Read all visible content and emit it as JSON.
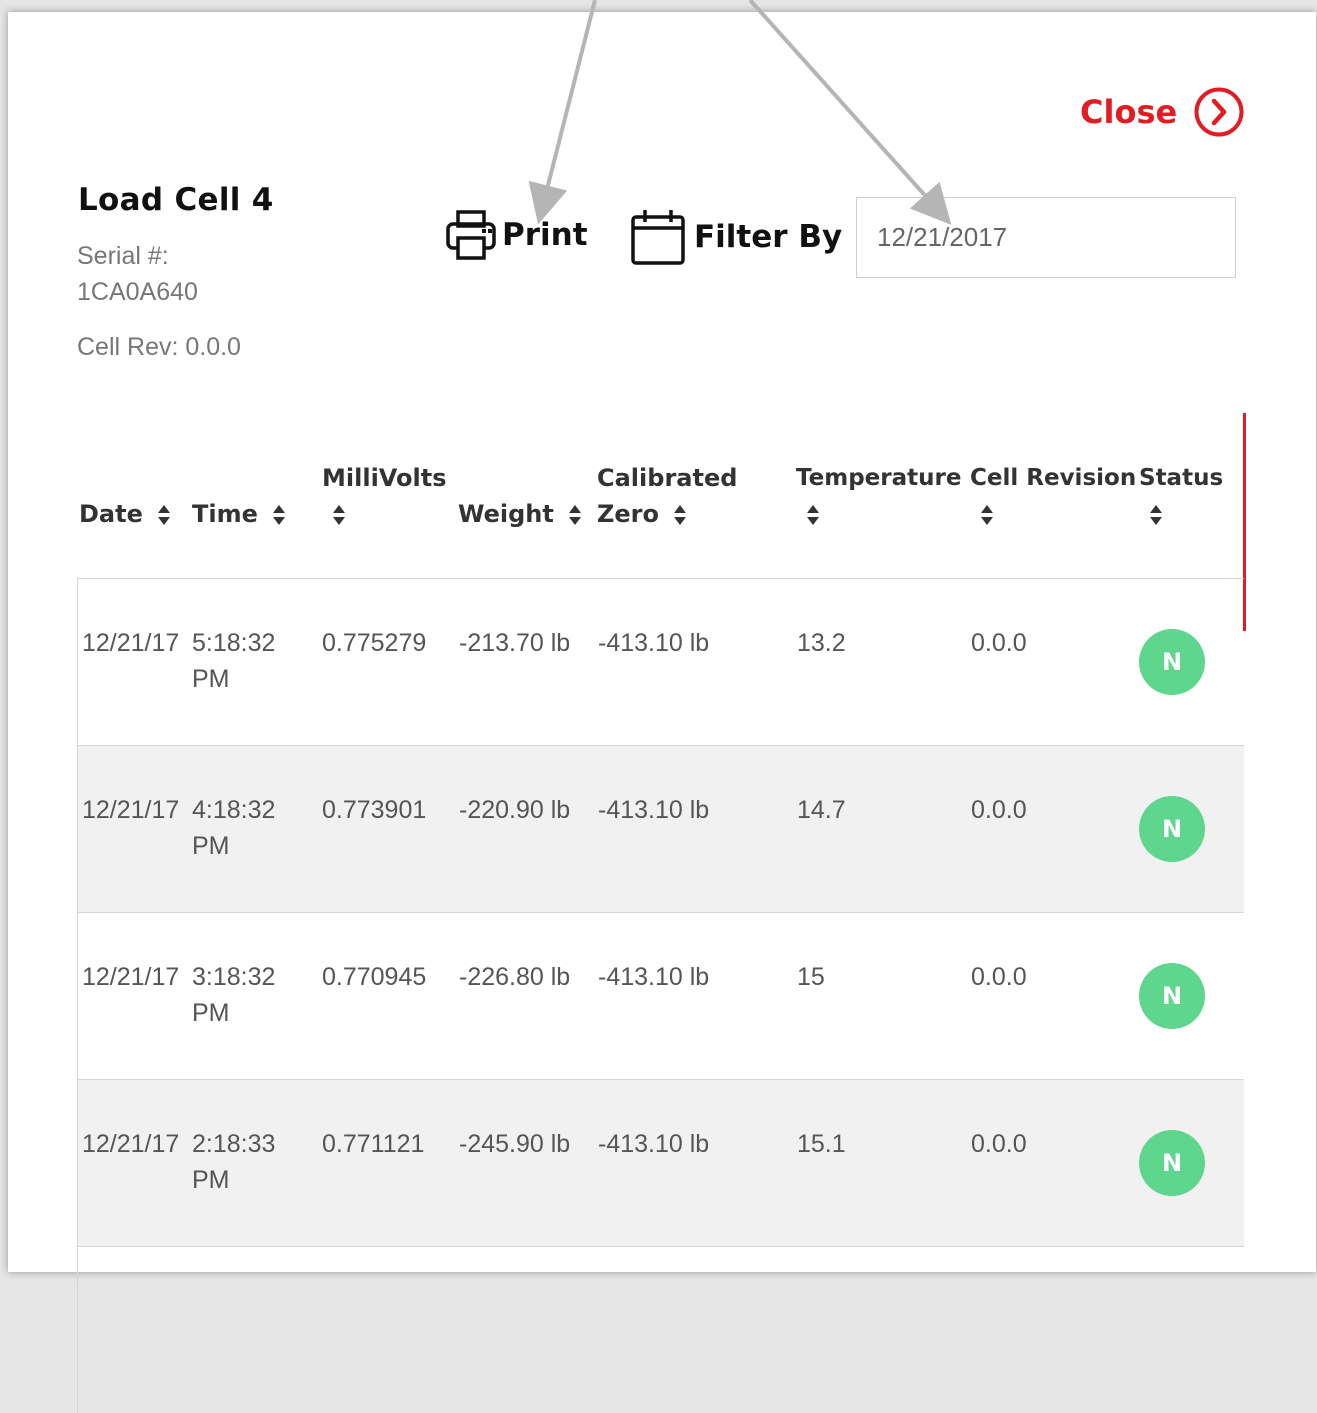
{
  "header": {
    "close_label": "Close",
    "title": "Load Cell 4",
    "serial_label": "Serial #:",
    "serial_value": "1CA0A640",
    "cell_rev": "Cell Rev: 0.0.0"
  },
  "toolbar": {
    "print_label": "Print",
    "filter_label": "Filter By",
    "filter_date": "12/21/2017"
  },
  "columns": [
    {
      "line1": "",
      "line2": "Date"
    },
    {
      "line1": "",
      "line2": "Time"
    },
    {
      "line1": "MilliVolts",
      "line2": ""
    },
    {
      "line1": "",
      "line2": "Weight"
    },
    {
      "line1": "Calibrated",
      "line2": "Zero"
    },
    {
      "line1": "Temperature",
      "line2": ""
    },
    {
      "line1": "Cell Revision",
      "line2": ""
    },
    {
      "line1": "Status",
      "line2": ""
    }
  ],
  "rows": [
    {
      "date": "12/21/17",
      "time1": "5:18:32",
      "time2": "PM",
      "millivolts": "0.775279",
      "weight": "-213.70 lb",
      "zero": "-413.10 lb",
      "temperature": "13.2",
      "revision": "0.0.0",
      "status": "N"
    },
    {
      "date": "12/21/17",
      "time1": "4:18:32",
      "time2": "PM",
      "millivolts": "0.773901",
      "weight": "-220.90 lb",
      "zero": "-413.10 lb",
      "temperature": "14.7",
      "revision": "0.0.0",
      "status": "N"
    },
    {
      "date": "12/21/17",
      "time1": "3:18:32",
      "time2": "PM",
      "millivolts": "0.770945",
      "weight": "-226.80 lb",
      "zero": "-413.10 lb",
      "temperature": "15",
      "revision": "0.0.0",
      "status": "N"
    },
    {
      "date": "12/21/17",
      "time1": "2:18:33",
      "time2": "PM",
      "millivolts": "0.771121",
      "weight": "-245.90 lb",
      "zero": "-413.10 lb",
      "temperature": "15.1",
      "revision": "0.0.0",
      "status": "N"
    }
  ],
  "colors": {
    "accent_red": "#e31b23",
    "status_green": "#5fd68d",
    "alt_row": "#f1f1f1"
  },
  "icons": {
    "close": "chevron-right-circle-icon",
    "print": "printer-icon",
    "filter": "calendar-icon",
    "sort": "sort-icon"
  }
}
